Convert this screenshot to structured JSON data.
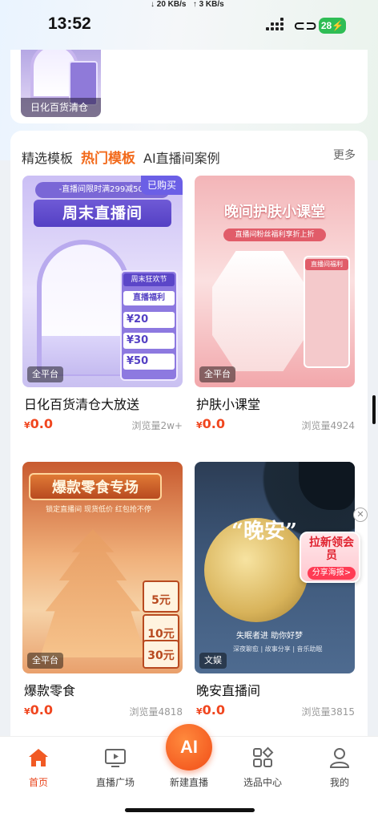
{
  "status": {
    "time": "13:52",
    "net_down": "↓ 20 KB/s",
    "net_up": "↑ 3 KB/s",
    "battery": "28"
  },
  "top_card": {
    "label": "日化百货清仓"
  },
  "tabs": [
    {
      "label": "精选模板"
    },
    {
      "label": "热门模板"
    },
    {
      "label": "AI直播间案例"
    }
  ],
  "more": "更多",
  "items": [
    {
      "name": "日化百货清仓大放送",
      "price": "0.0",
      "currency": "¥",
      "views": "浏览量2w+",
      "tag": "全平台",
      "bought": "已购买",
      "img": {
        "band": "-直播间限时满299减50-",
        "title": "周末直播间",
        "p1": "周末狂欢节",
        "p2": "直播福利",
        "c1": "20",
        "c2": "30",
        "c3": "50"
      }
    },
    {
      "name": "护肤小课堂",
      "price": "0.0",
      "currency": "¥",
      "views": "浏览量4924",
      "tag": "全平台",
      "img": {
        "title": "晚间护肤小课堂",
        "band": "直播间粉丝福利享折上折",
        "p1": "直播间福利"
      }
    },
    {
      "name": "爆款零食",
      "price": "0.0",
      "currency": "¥",
      "views": "浏览量4818",
      "tag": "全平台",
      "img": {
        "title": "爆款零食专场",
        "band": "锁定直播间 现货低价 红包抢不停",
        "c1": "5元",
        "c2": "10元",
        "c3": "30元"
      }
    },
    {
      "name": "晚安直播间",
      "price": "0.0",
      "currency": "¥",
      "views": "浏览量3815",
      "tag": "文娱",
      "img": {
        "quote": "“晚安”",
        "cap": "失眠者进 助你好梦",
        "cap2": "深夜聊愈 | 故事分享 | 音乐助眠"
      }
    }
  ],
  "promo": {
    "title": "拉新领会员",
    "button": "分享海报>"
  },
  "nav": [
    {
      "label": "首页"
    },
    {
      "label": "直播广场"
    },
    {
      "label": "新建直播"
    },
    {
      "label": "选品中心"
    },
    {
      "label": "我的"
    }
  ],
  "ai_button": "AI",
  "colors": {
    "accent": "#f26a1b",
    "price": "#f0461f",
    "battery": "#2fbd55"
  }
}
